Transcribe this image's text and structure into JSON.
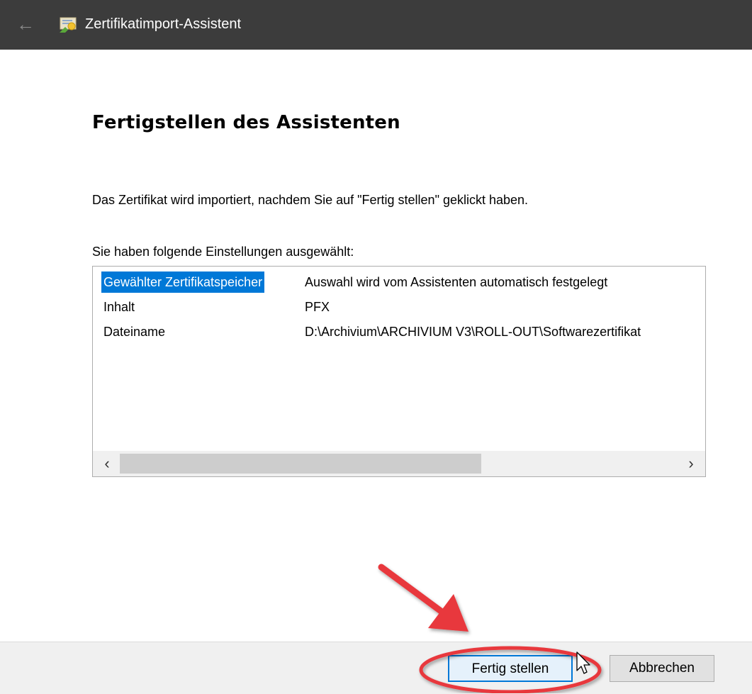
{
  "window": {
    "title": "Zertifikatimport-Assistent",
    "back_icon": "back-arrow-icon",
    "app_icon": "certificate-icon"
  },
  "main": {
    "heading": "Fertigstellen des Assistenten",
    "description": "Das Zertifikat wird importiert, nachdem Sie auf \"Fertig stellen\" geklickt haben.",
    "settings_label": "Sie haben folgende Einstellungen ausgewählt:",
    "settings": [
      {
        "key": "Gewählter Zertifikatspeicher",
        "value": "Auswahl wird vom Assistenten automatisch festgelegt",
        "selected": true
      },
      {
        "key": "Inhalt",
        "value": "PFX",
        "selected": false
      },
      {
        "key": "Dateiname",
        "value": "D:\\Archivium\\ARCHIVIUM V3\\ROLL-OUT\\Softwarezertifikat",
        "selected": false
      }
    ],
    "scroll_left": "‹",
    "scroll_right": "›"
  },
  "footer": {
    "finish_label": "Fertig stellen",
    "cancel_label": "Abbrechen"
  },
  "annotation": {
    "arrow_color": "#e8383d",
    "highlight_color": "#e8383d"
  },
  "colors": {
    "titlebar": "#3c3c3c",
    "selection": "#0078d7",
    "footer": "#f0f0f0"
  }
}
